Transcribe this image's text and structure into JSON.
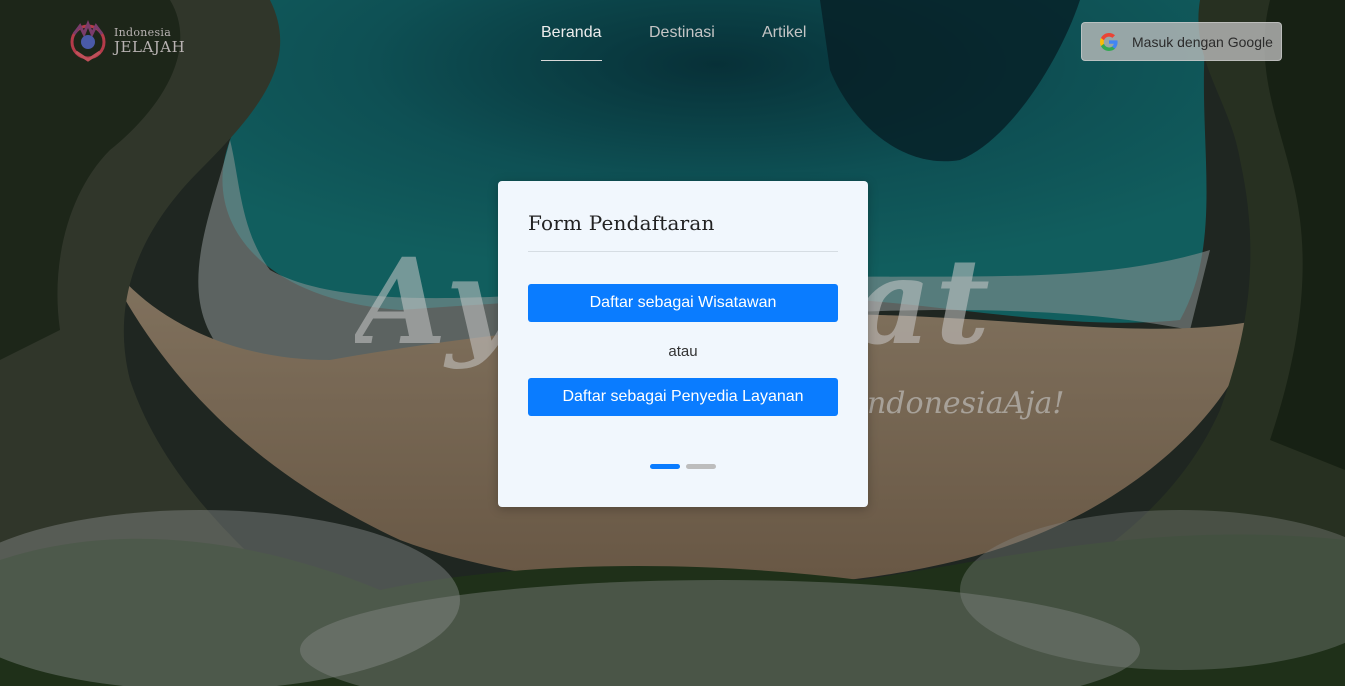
{
  "brand": {
    "top": "Indonesia",
    "bottom": "JELAJAH"
  },
  "nav": {
    "items": [
      {
        "label": "Beranda",
        "active": true
      },
      {
        "label": "Destinasi",
        "active": false
      },
      {
        "label": "Artikel",
        "active": false
      }
    ]
  },
  "auth": {
    "google_label": "Masuk dengan Google",
    "icon": "google-icon"
  },
  "hero": {
    "script_text": "AyoWisata",
    "sub_text": "#IndonesiaAja!"
  },
  "modal": {
    "title": "Form Pendaftaran",
    "btn_tourist": "Daftar sebagai Wisatawan",
    "or_text": "atau",
    "btn_provider": "Daftar sebagai Penyedia Layanan",
    "carousel": {
      "total": 2,
      "active_index": 0
    }
  },
  "colors": {
    "primary": "#0a7cff",
    "modal_bg": "#f1f7fd",
    "indicator_inactive": "#bdbdbd"
  }
}
